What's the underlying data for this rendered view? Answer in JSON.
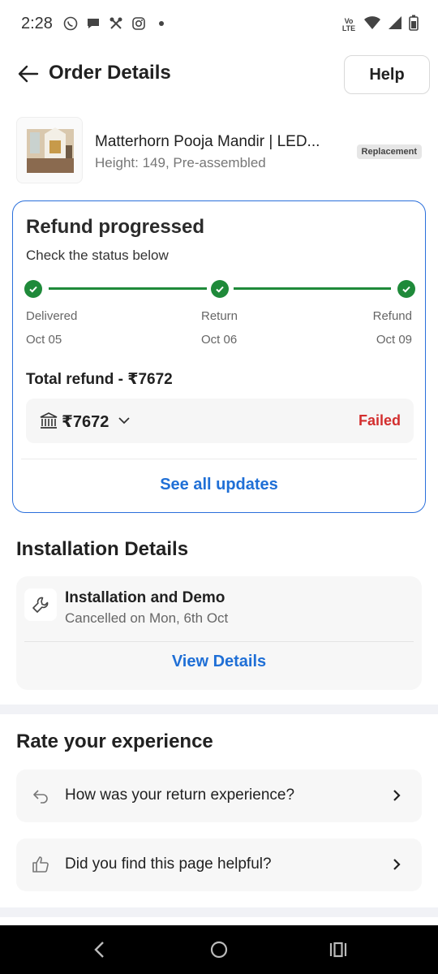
{
  "status_bar": {
    "time": "2:28",
    "left_icons": [
      "whatsapp-icon",
      "chat-icon",
      "tool-icon",
      "instagram-icon",
      "dot-icon"
    ],
    "right_icons": [
      "volte-icon",
      "wifi-icon",
      "signal-icon",
      "battery-icon"
    ],
    "volte_label": "Vo LTE"
  },
  "header": {
    "title": "Order Details",
    "help_label": "Help"
  },
  "product": {
    "title": "Matterhorn Pooja Mandir | LED...",
    "subtitle": "Height: 149, Pre-assembled",
    "badge": "Replacement"
  },
  "refund": {
    "title": "Refund progressed",
    "subtitle": "Check the status below",
    "steps": [
      {
        "label": "Delivered",
        "date": "Oct 05"
      },
      {
        "label": "Return",
        "date": "Oct 06"
      },
      {
        "label": "Refund",
        "date": "Oct 09"
      }
    ],
    "total_label": "Total refund - ₹7672",
    "amount": "₹7672",
    "status": "Failed",
    "see_all": "See all updates",
    "colors": {
      "accent": "#1f6fd6",
      "success": "#1f8a3a",
      "failed": "#d32f2f",
      "border": "#2a6fdb"
    }
  },
  "installation": {
    "section_title": "Installation Details",
    "name": "Installation and Demo",
    "status": "Cancelled on Mon, 6th Oct",
    "view_details": "View Details"
  },
  "rate": {
    "section_title": "Rate your experience",
    "items": [
      {
        "icon": "return-arrow-icon",
        "label": "How was your return experience?"
      },
      {
        "icon": "thumbs-up-icon",
        "label": "Did you find this page helpful?"
      }
    ]
  },
  "nav_bar": {
    "buttons": [
      "back-nav-icon",
      "home-nav-icon",
      "recents-nav-icon"
    ]
  }
}
